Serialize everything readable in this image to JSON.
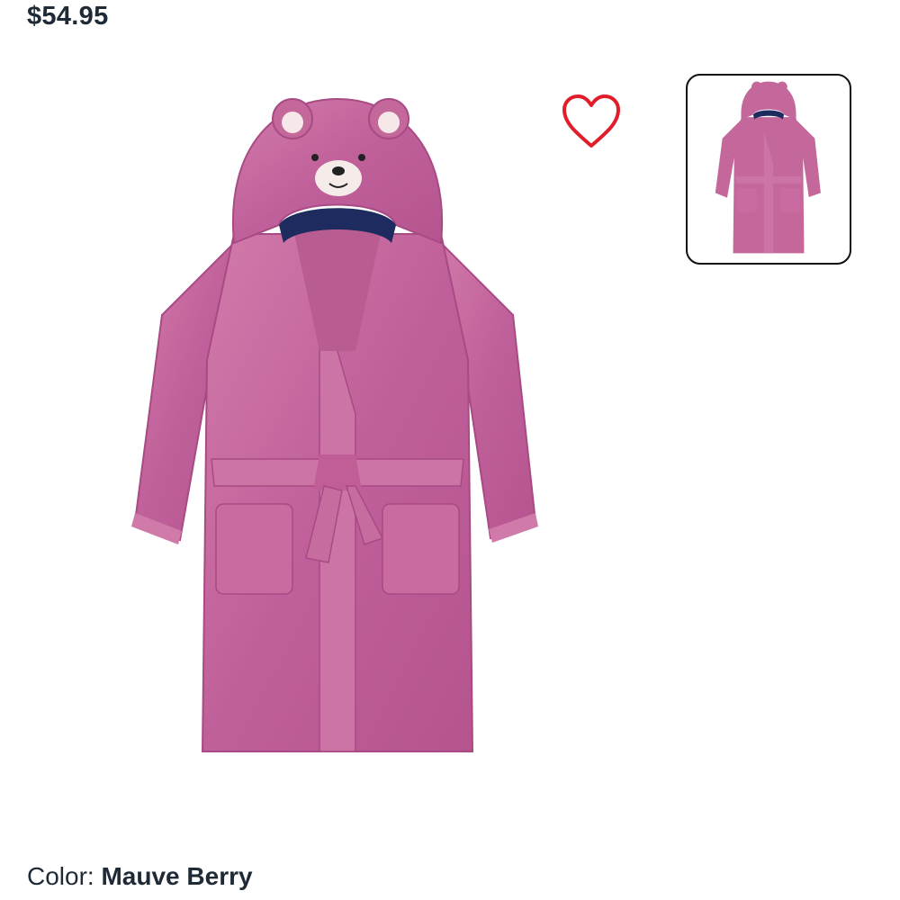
{
  "product": {
    "price": "$54.95",
    "color_label": "Color:",
    "color_value": "Mauve Berry",
    "main_image": {
      "icon": "bathrobe-image",
      "robe_color": "#c4679a",
      "lining_color": "#1d2b5e"
    },
    "thumbnails": [
      {
        "icon": "bathrobe-thumbnail",
        "selected": true
      }
    ]
  },
  "wishlist": {
    "icon": "heart-icon",
    "color": "#e11d2a"
  },
  "colors": {
    "text": "#1f2a37",
    "accent": "#e11d2a"
  }
}
